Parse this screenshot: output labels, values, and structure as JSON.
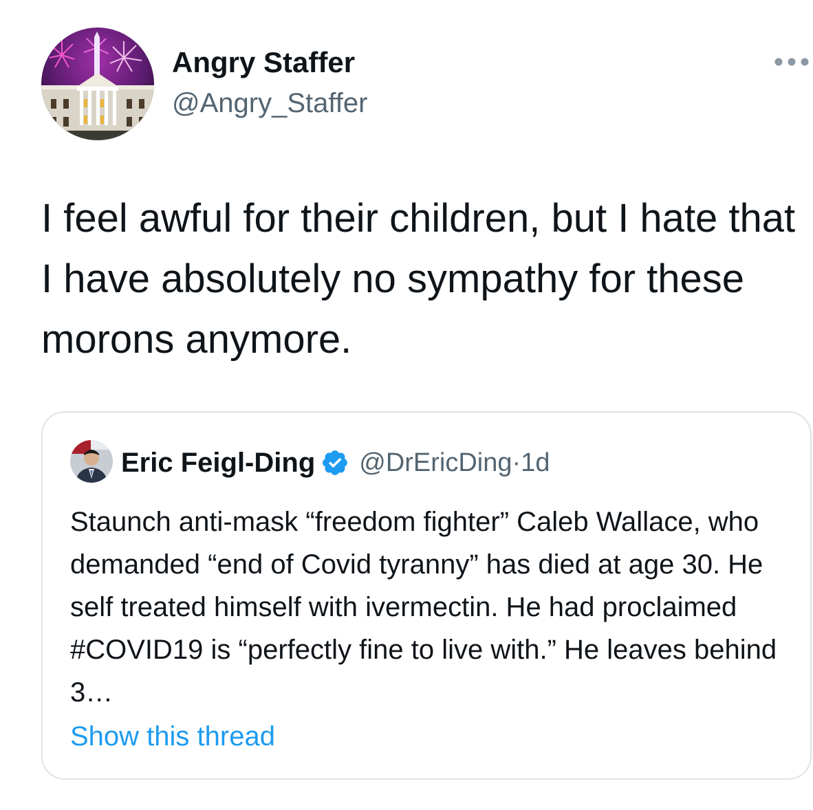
{
  "author": {
    "name": "Angry Staffer",
    "handle": "@Angry_Staffer",
    "avatar_icon": "white-house-fireworks-avatar"
  },
  "tweet": {
    "text": "I feel awful for their children, but I hate that I have absolutely no sympathy for these morons anymore."
  },
  "menu": {
    "icon": "more-options-icon"
  },
  "quote": {
    "name": "Eric Feigl-Ding",
    "verified_icon": "verified-badge-icon",
    "handle": "@DrEricDing",
    "separator": " · ",
    "time": "1d",
    "text": "Staunch anti-mask “freedom fighter” Caleb Wallace, who demanded “end of Covid tyranny” has died at age 30. He self treated himself with ivermectin. He had proclaimed #COVID19 is “perfectly fine to live with.” He leaves behind 3…",
    "show_thread": "Show this thread"
  },
  "colors": {
    "text": "#0f1419",
    "secondary": "#536471",
    "link": "#1d9bf0",
    "verified": "#1d9bf0",
    "border": "#dfe3e6"
  }
}
